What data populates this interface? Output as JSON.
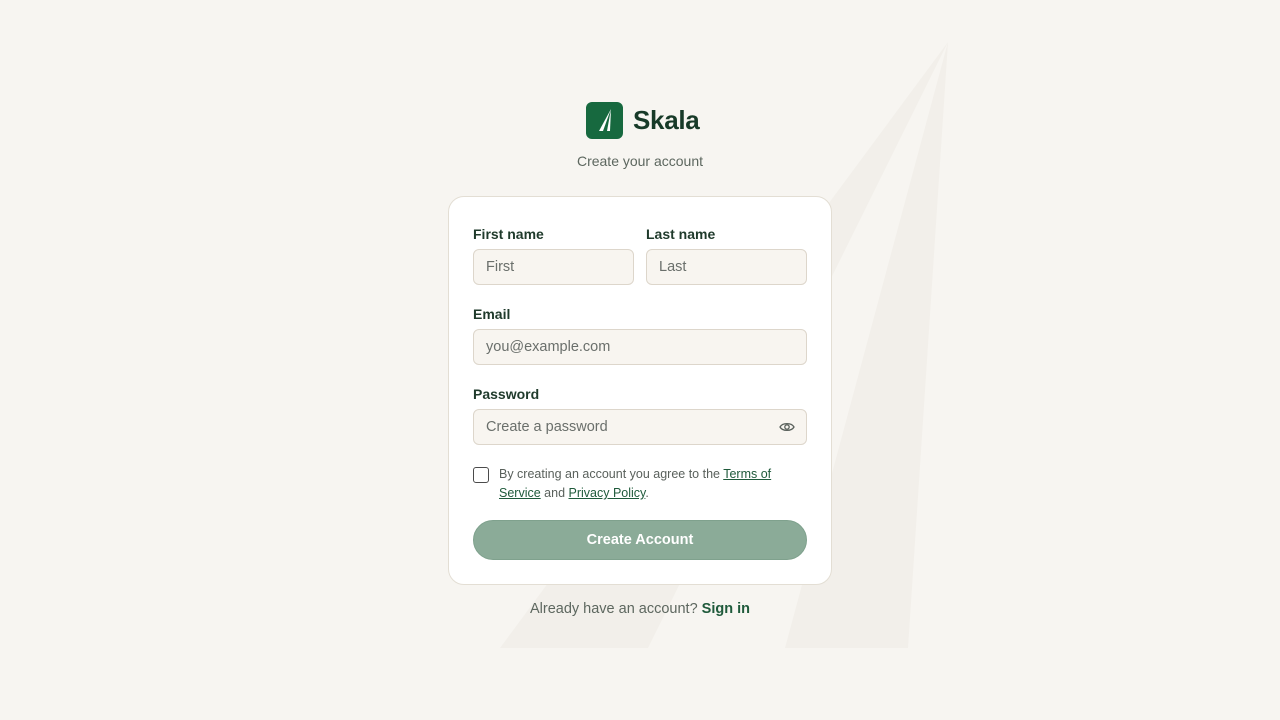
{
  "brand": {
    "name": "Skala",
    "logo_icon": "skala-logo-icon",
    "accent_color": "#17693f"
  },
  "subtitle": "Create your account",
  "form": {
    "first_name": {
      "label": "First name",
      "placeholder": "First",
      "value": ""
    },
    "last_name": {
      "label": "Last name",
      "placeholder": "Last",
      "value": ""
    },
    "email": {
      "label": "Email",
      "placeholder": "you@example.com",
      "value": ""
    },
    "password": {
      "label": "Password",
      "placeholder": "Create a password",
      "value": "",
      "toggle_icon": "eye-icon"
    },
    "terms": {
      "checked": false,
      "prefix": "By creating an account you agree to the ",
      "terms_link": "Terms of Service",
      "middle": " and ",
      "privacy_link": "Privacy Policy",
      "suffix": "."
    },
    "submit_label": "Create Account",
    "submit_color": "#8bab98"
  },
  "footer": {
    "prompt": "Already have an account?",
    "link": "Sign in"
  }
}
